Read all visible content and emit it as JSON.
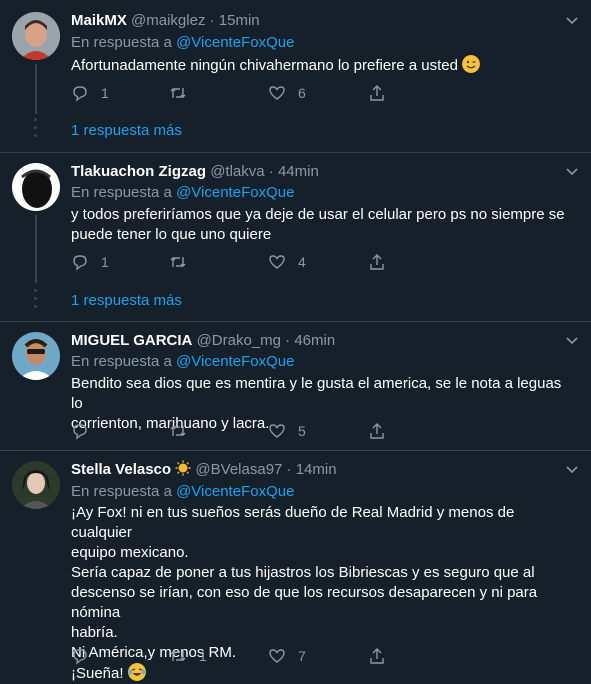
{
  "reply_prefix": "En respuesta a",
  "tweets": [
    {
      "name": "MaikMX",
      "handle": "@maikglez",
      "time": "15min",
      "reply_to": "@VicenteFoxQue",
      "text": [
        "Afortunadamente ningún chivahermano lo prefiere a usted"
      ],
      "emoji": "wink-emoji",
      "replies": "1",
      "retweets": "",
      "likes": "6",
      "more_replies": "1 respuesta más"
    },
    {
      "name": "Tlakuachon Zigzag",
      "handle": "@tlakva",
      "time": "44min",
      "reply_to": "@VicenteFoxQue",
      "text": [
        "y todos preferiríamos que ya deje de usar el celular pero ps no siempre se",
        "puede tener lo que uno quiere"
      ],
      "replies": "1",
      "retweets": "",
      "likes": "4",
      "more_replies": "1 respuesta más"
    },
    {
      "name": "MIGUEL GARCIA",
      "handle": "@Drako_mg",
      "time": "46min",
      "reply_to": "@VicenteFoxQue",
      "text": [
        "Bendito sea dios que es mentira y le gusta el america, se le nota a leguas lo",
        "corrienton, marihuano y lacra."
      ],
      "replies": "",
      "retweets": "",
      "likes": "5"
    },
    {
      "name": "Stella Velasco",
      "handle": "@BVelasa97",
      "time": "14min",
      "reply_to": "@VicenteFoxQue",
      "text": [
        "¡Ay Fox! ni en tus sueños serás dueño de Real Madrid y menos de cualquier",
        "equipo mexicano.",
        "Sería capaz de poner a tus hijastros los Bibriescas y es seguro que al",
        "descenso se irían, con eso de que los recursos desaparecen y ni para nómina",
        "habría.",
        "Ni América,y menos RM.",
        "¡Sueña!"
      ],
      "emoji": "laughing-tears-emoji",
      "replies": "",
      "retweets": "1",
      "likes": "7"
    }
  ]
}
